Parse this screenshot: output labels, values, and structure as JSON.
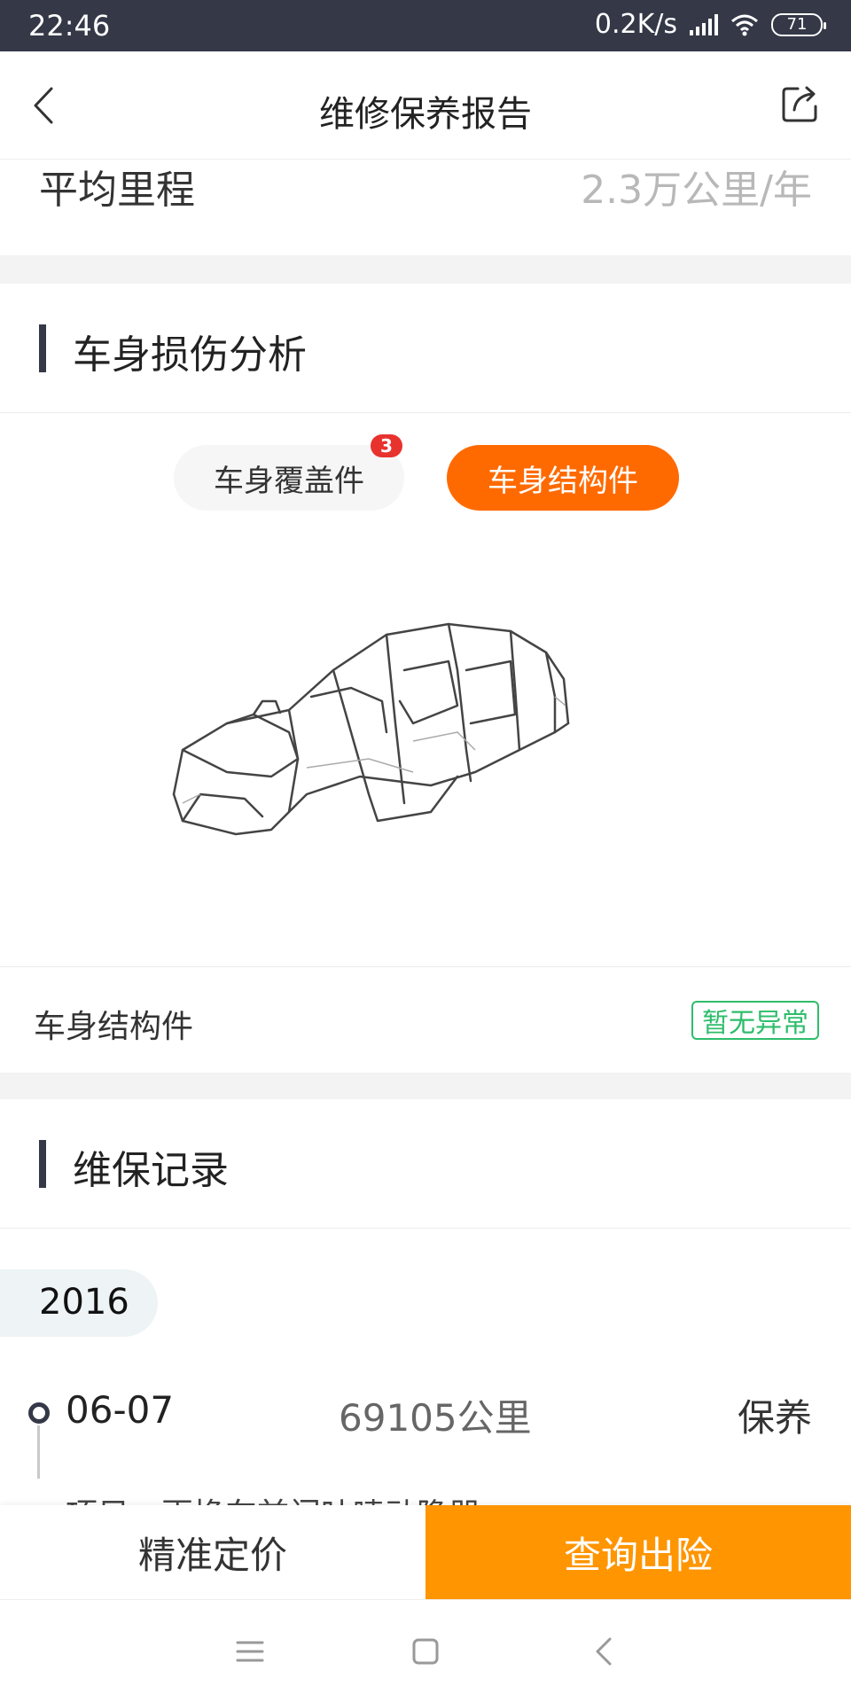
{
  "status_bar": {
    "time": "22:46",
    "network_speed": "0.2K/s",
    "battery": "71"
  },
  "nav": {
    "title": "维修保养报告"
  },
  "mileage": {
    "label": "平均里程",
    "value": "2.3万公里/年"
  },
  "damage_section": {
    "title": "车身损伤分析",
    "tabs": [
      {
        "label": "车身覆盖件",
        "badge": "3",
        "selected": false
      },
      {
        "label": "车身结构件",
        "selected": true
      }
    ],
    "result_label": "车身结构件",
    "result_status": "暂无异常"
  },
  "maintenance_section": {
    "title": "维保记录",
    "year": "2016",
    "records": [
      {
        "date": "06-07",
        "mileage": "69105公里",
        "type": "保养",
        "detail": "项目：更换车前门吐喷动隐器"
      }
    ]
  },
  "actions": {
    "price_label": "精准定价",
    "insurance_label": "查询出险"
  },
  "colors": {
    "accent_orange": "#ff6a00",
    "button_orange": "#ff9500",
    "status_green": "#2ebd6b",
    "badge_red": "#e8322e",
    "dark": "#343847"
  }
}
